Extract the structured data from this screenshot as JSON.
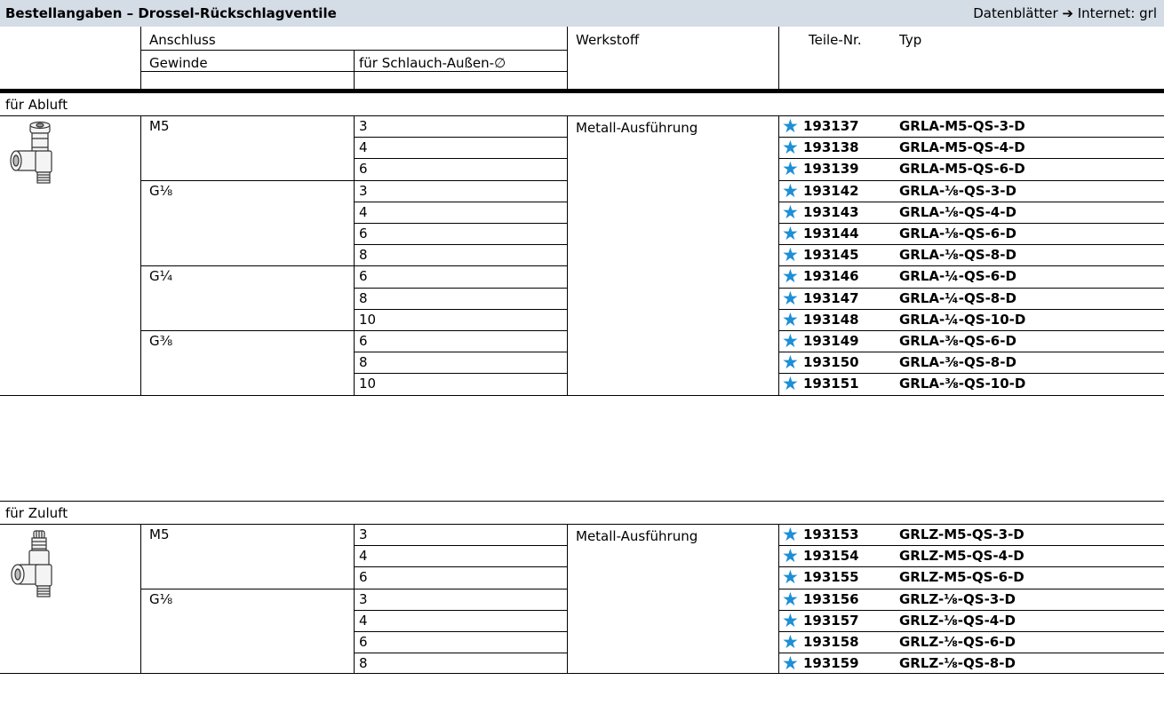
{
  "title": "Bestellangaben – Drossel-Rückschlagventile",
  "datasheet_ref": "Datenblätter ➔ Internet: grl",
  "headers": {
    "anschluss": "Anschluss",
    "gewinde": "Gewinde",
    "schlauch": "für Schlauch-Außen-∅",
    "werkstoff": "Werkstoff",
    "teile_nr": "Teile-Nr.",
    "typ": "Typ"
  },
  "icons": {
    "product": "star-icon"
  },
  "accent_color": "#1d8fd6",
  "sections": [
    {
      "label": "für Abluft",
      "material": "Metall-Ausführung",
      "icon": "angle-fitting-exhaust-image",
      "rows": [
        {
          "gewinde": "M5",
          "schlauch": "3",
          "teil": "193137",
          "typ": "GRLA-M5-QS-3-D"
        },
        {
          "gewinde": "",
          "schlauch": "4",
          "teil": "193138",
          "typ": "GRLA-M5-QS-4-D"
        },
        {
          "gewinde": "",
          "schlauch": "6",
          "teil": "193139",
          "typ": "GRLA-M5-QS-6-D"
        },
        {
          "gewinde": "G⅛",
          "schlauch": "3",
          "teil": "193142",
          "typ": "GRLA-⅛-QS-3-D"
        },
        {
          "gewinde": "",
          "schlauch": "4",
          "teil": "193143",
          "typ": "GRLA-⅛-QS-4-D"
        },
        {
          "gewinde": "",
          "schlauch": "6",
          "teil": "193144",
          "typ": "GRLA-⅛-QS-6-D"
        },
        {
          "gewinde": "",
          "schlauch": "8",
          "teil": "193145",
          "typ": "GRLA-⅛-QS-8-D"
        },
        {
          "gewinde": "G¼",
          "schlauch": "6",
          "teil": "193146",
          "typ": "GRLA-¼-QS-6-D"
        },
        {
          "gewinde": "",
          "schlauch": "8",
          "teil": "193147",
          "typ": "GRLA-¼-QS-8-D"
        },
        {
          "gewinde": "",
          "schlauch": "10",
          "teil": "193148",
          "typ": "GRLA-¼-QS-10-D"
        },
        {
          "gewinde": "G⅜",
          "schlauch": "6",
          "teil": "193149",
          "typ": "GRLA-⅜-QS-6-D"
        },
        {
          "gewinde": "",
          "schlauch": "8",
          "teil": "193150",
          "typ": "GRLA-⅜-QS-8-D"
        },
        {
          "gewinde": "",
          "schlauch": "10",
          "teil": "193151",
          "typ": "GRLA-⅜-QS-10-D"
        }
      ]
    },
    {
      "label": "für Zuluft",
      "material": "Metall-Ausführung",
      "icon": "angle-fitting-supply-image",
      "rows": [
        {
          "gewinde": "M5",
          "schlauch": "3",
          "teil": "193153",
          "typ": "GRLZ-M5-QS-3-D"
        },
        {
          "gewinde": "",
          "schlauch": "4",
          "teil": "193154",
          "typ": "GRLZ-M5-QS-4-D"
        },
        {
          "gewinde": "",
          "schlauch": "6",
          "teil": "193155",
          "typ": "GRLZ-M5-QS-6-D"
        },
        {
          "gewinde": "G⅛",
          "schlauch": "3",
          "teil": "193156",
          "typ": "GRLZ-⅛-QS-3-D"
        },
        {
          "gewinde": "",
          "schlauch": "4",
          "teil": "193157",
          "typ": "GRLZ-⅛-QS-4-D"
        },
        {
          "gewinde": "",
          "schlauch": "6",
          "teil": "193158",
          "typ": "GRLZ-⅛-QS-6-D"
        },
        {
          "gewinde": "",
          "schlauch": "8",
          "teil": "193159",
          "typ": "GRLZ-⅛-QS-8-D"
        }
      ]
    }
  ]
}
